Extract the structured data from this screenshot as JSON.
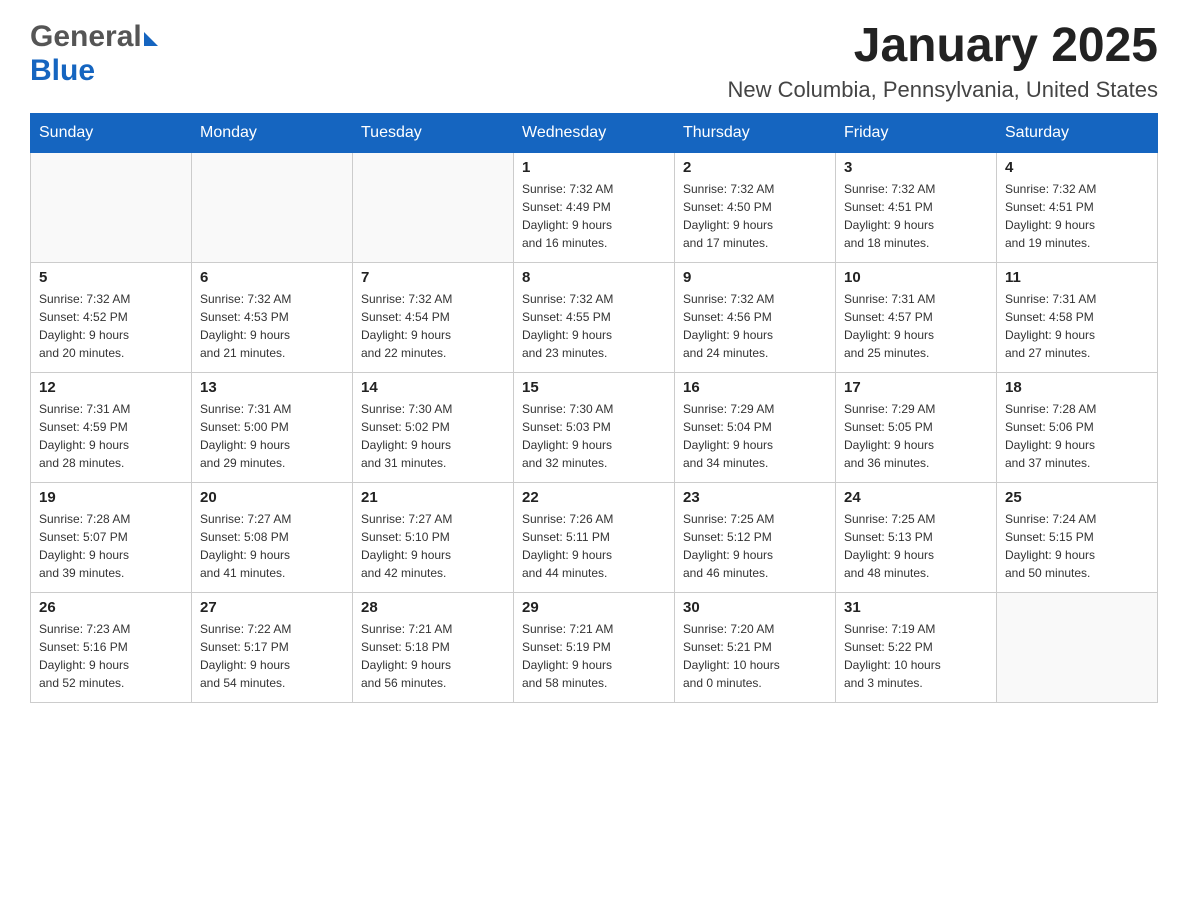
{
  "header": {
    "logo_general": "General",
    "logo_blue": "Blue",
    "month_title": "January 2025",
    "location": "New Columbia, Pennsylvania, United States"
  },
  "weekdays": [
    "Sunday",
    "Monday",
    "Tuesday",
    "Wednesday",
    "Thursday",
    "Friday",
    "Saturday"
  ],
  "weeks": [
    [
      {
        "day": "",
        "info": ""
      },
      {
        "day": "",
        "info": ""
      },
      {
        "day": "",
        "info": ""
      },
      {
        "day": "1",
        "info": "Sunrise: 7:32 AM\nSunset: 4:49 PM\nDaylight: 9 hours\nand 16 minutes."
      },
      {
        "day": "2",
        "info": "Sunrise: 7:32 AM\nSunset: 4:50 PM\nDaylight: 9 hours\nand 17 minutes."
      },
      {
        "day": "3",
        "info": "Sunrise: 7:32 AM\nSunset: 4:51 PM\nDaylight: 9 hours\nand 18 minutes."
      },
      {
        "day": "4",
        "info": "Sunrise: 7:32 AM\nSunset: 4:51 PM\nDaylight: 9 hours\nand 19 minutes."
      }
    ],
    [
      {
        "day": "5",
        "info": "Sunrise: 7:32 AM\nSunset: 4:52 PM\nDaylight: 9 hours\nand 20 minutes."
      },
      {
        "day": "6",
        "info": "Sunrise: 7:32 AM\nSunset: 4:53 PM\nDaylight: 9 hours\nand 21 minutes."
      },
      {
        "day": "7",
        "info": "Sunrise: 7:32 AM\nSunset: 4:54 PM\nDaylight: 9 hours\nand 22 minutes."
      },
      {
        "day": "8",
        "info": "Sunrise: 7:32 AM\nSunset: 4:55 PM\nDaylight: 9 hours\nand 23 minutes."
      },
      {
        "day": "9",
        "info": "Sunrise: 7:32 AM\nSunset: 4:56 PM\nDaylight: 9 hours\nand 24 minutes."
      },
      {
        "day": "10",
        "info": "Sunrise: 7:31 AM\nSunset: 4:57 PM\nDaylight: 9 hours\nand 25 minutes."
      },
      {
        "day": "11",
        "info": "Sunrise: 7:31 AM\nSunset: 4:58 PM\nDaylight: 9 hours\nand 27 minutes."
      }
    ],
    [
      {
        "day": "12",
        "info": "Sunrise: 7:31 AM\nSunset: 4:59 PM\nDaylight: 9 hours\nand 28 minutes."
      },
      {
        "day": "13",
        "info": "Sunrise: 7:31 AM\nSunset: 5:00 PM\nDaylight: 9 hours\nand 29 minutes."
      },
      {
        "day": "14",
        "info": "Sunrise: 7:30 AM\nSunset: 5:02 PM\nDaylight: 9 hours\nand 31 minutes."
      },
      {
        "day": "15",
        "info": "Sunrise: 7:30 AM\nSunset: 5:03 PM\nDaylight: 9 hours\nand 32 minutes."
      },
      {
        "day": "16",
        "info": "Sunrise: 7:29 AM\nSunset: 5:04 PM\nDaylight: 9 hours\nand 34 minutes."
      },
      {
        "day": "17",
        "info": "Sunrise: 7:29 AM\nSunset: 5:05 PM\nDaylight: 9 hours\nand 36 minutes."
      },
      {
        "day": "18",
        "info": "Sunrise: 7:28 AM\nSunset: 5:06 PM\nDaylight: 9 hours\nand 37 minutes."
      }
    ],
    [
      {
        "day": "19",
        "info": "Sunrise: 7:28 AM\nSunset: 5:07 PM\nDaylight: 9 hours\nand 39 minutes."
      },
      {
        "day": "20",
        "info": "Sunrise: 7:27 AM\nSunset: 5:08 PM\nDaylight: 9 hours\nand 41 minutes."
      },
      {
        "day": "21",
        "info": "Sunrise: 7:27 AM\nSunset: 5:10 PM\nDaylight: 9 hours\nand 42 minutes."
      },
      {
        "day": "22",
        "info": "Sunrise: 7:26 AM\nSunset: 5:11 PM\nDaylight: 9 hours\nand 44 minutes."
      },
      {
        "day": "23",
        "info": "Sunrise: 7:25 AM\nSunset: 5:12 PM\nDaylight: 9 hours\nand 46 minutes."
      },
      {
        "day": "24",
        "info": "Sunrise: 7:25 AM\nSunset: 5:13 PM\nDaylight: 9 hours\nand 48 minutes."
      },
      {
        "day": "25",
        "info": "Sunrise: 7:24 AM\nSunset: 5:15 PM\nDaylight: 9 hours\nand 50 minutes."
      }
    ],
    [
      {
        "day": "26",
        "info": "Sunrise: 7:23 AM\nSunset: 5:16 PM\nDaylight: 9 hours\nand 52 minutes."
      },
      {
        "day": "27",
        "info": "Sunrise: 7:22 AM\nSunset: 5:17 PM\nDaylight: 9 hours\nand 54 minutes."
      },
      {
        "day": "28",
        "info": "Sunrise: 7:21 AM\nSunset: 5:18 PM\nDaylight: 9 hours\nand 56 minutes."
      },
      {
        "day": "29",
        "info": "Sunrise: 7:21 AM\nSunset: 5:19 PM\nDaylight: 9 hours\nand 58 minutes."
      },
      {
        "day": "30",
        "info": "Sunrise: 7:20 AM\nSunset: 5:21 PM\nDaylight: 10 hours\nand 0 minutes."
      },
      {
        "day": "31",
        "info": "Sunrise: 7:19 AM\nSunset: 5:22 PM\nDaylight: 10 hours\nand 3 minutes."
      },
      {
        "day": "",
        "info": ""
      }
    ]
  ]
}
